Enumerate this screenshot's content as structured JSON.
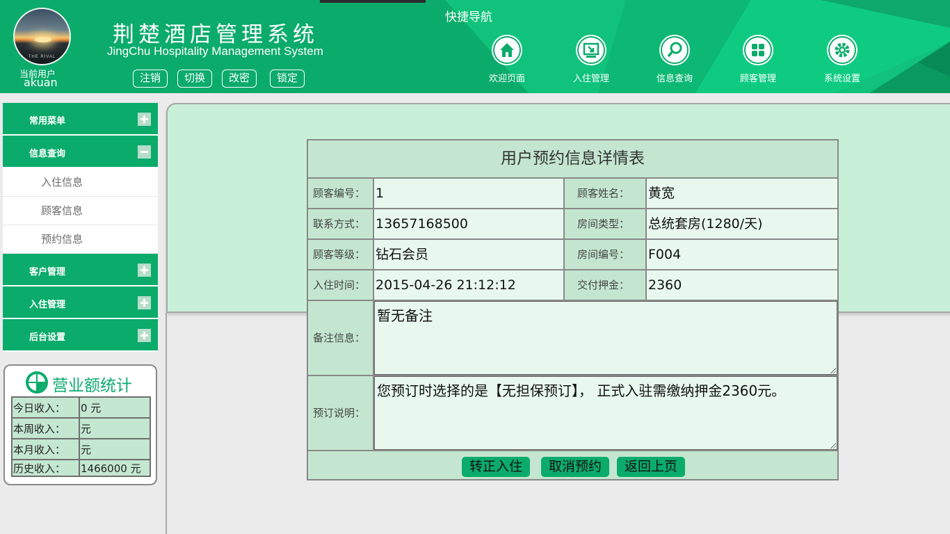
{
  "header": {
    "title": "荆楚酒店管理系统",
    "subtitle": "JingChu Hospitality Management System",
    "current_user_label": "当前用户",
    "current_user": "akuan",
    "avatar_caption": "THE RIVAL",
    "buttons": [
      "注销",
      "切换",
      "改密",
      "锁定"
    ],
    "quicknav_title": "快捷导航",
    "nav": [
      {
        "label": "欢迎页面",
        "icon": "home-icon"
      },
      {
        "label": "入住管理",
        "icon": "checkin-icon"
      },
      {
        "label": "信息查询",
        "icon": "search-icon"
      },
      {
        "label": "顾客管理",
        "icon": "grid-icon"
      },
      {
        "label": "系统设置",
        "icon": "gear-icon"
      }
    ]
  },
  "sidebar": {
    "groups": [
      {
        "label": "常用菜单",
        "expanded": false,
        "items": []
      },
      {
        "label": "信息查询",
        "expanded": true,
        "items": [
          "入住信息",
          "顾客信息",
          "预约信息"
        ]
      },
      {
        "label": "客户管理",
        "expanded": false,
        "items": []
      },
      {
        "label": "入住管理",
        "expanded": false,
        "items": []
      },
      {
        "label": "后台设置",
        "expanded": false,
        "items": []
      }
    ]
  },
  "stats": {
    "title": "营业额统计",
    "rows": [
      {
        "label": "今日收入：",
        "value": "0 元"
      },
      {
        "label": "本周收入：",
        "value": "元"
      },
      {
        "label": "本月收入：",
        "value": "元"
      },
      {
        "label": "历史收入：",
        "value": "1466000 元"
      }
    ]
  },
  "detail": {
    "title": "用户预约信息详情表",
    "fields": {
      "customer_id_label": "顾客编号：",
      "customer_id": "1",
      "customer_name_label": "顾客姓名：",
      "customer_name": "黄宽",
      "contact_label": "联系方式：",
      "contact": "13657168500",
      "room_type_label": "房间类型：",
      "room_type": "总统套房(1280/天)",
      "level_label": "顾客等级：",
      "level": "钻石会员",
      "room_no_label": "房间编号：",
      "room_no": "F004",
      "checkin_time_label": "入住时间：",
      "checkin_time": "2015-04-26 21:12:12",
      "deposit_label": "交付押金：",
      "deposit": "2360",
      "remark_label": "备注信息：",
      "remark": "暂无备注",
      "booking_note_label": "预订说明：",
      "booking_note": "您预订时选择的是【无担保预订】， 正式入驻需缴纳押金2360元。"
    },
    "actions": [
      "转正入住",
      "取消预约",
      "返回上页"
    ]
  },
  "colors": {
    "brand": "#0bab6c",
    "panel": "#c8f0d8",
    "cell": "#e8f8ee",
    "label_cell": "#c4e6d0"
  }
}
